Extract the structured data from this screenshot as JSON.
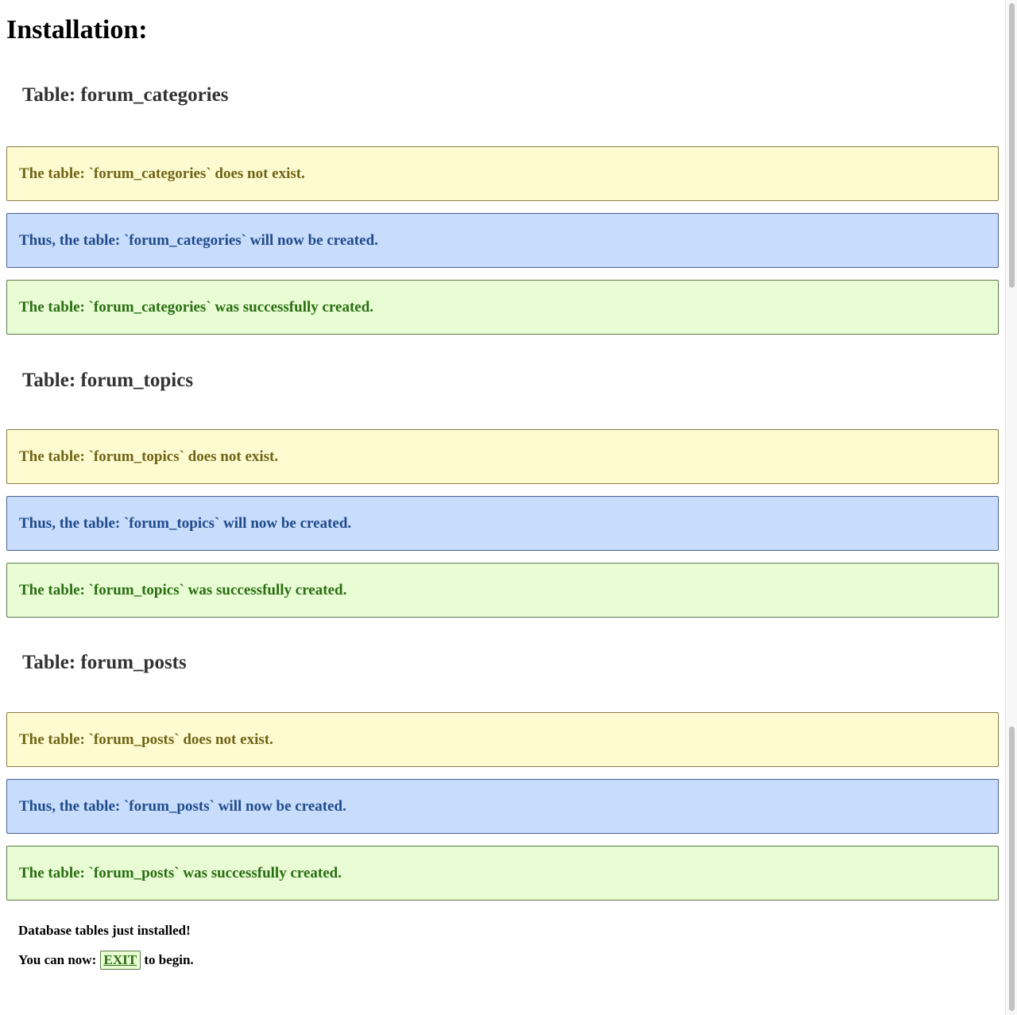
{
  "page": {
    "title": "Installation:"
  },
  "sections": [
    {
      "heading": "Table: forum_categories",
      "messages": [
        {
          "type": "warn",
          "text": "The table: `forum_categories` does not exist."
        },
        {
          "type": "info",
          "text": "Thus, the table: `forum_categories` will now be created."
        },
        {
          "type": "success",
          "text": "The table: `forum_categories` was successfully created."
        }
      ]
    },
    {
      "heading": "Table: forum_topics",
      "messages": [
        {
          "type": "warn",
          "text": "The table: `forum_topics` does not exist."
        },
        {
          "type": "info",
          "text": "Thus, the table: `forum_topics` will now be created."
        },
        {
          "type": "success",
          "text": "The table: `forum_topics` was successfully created."
        }
      ]
    },
    {
      "heading": "Table: forum_posts",
      "messages": [
        {
          "type": "warn",
          "text": "The table: `forum_posts` does not exist."
        },
        {
          "type": "info",
          "text": "Thus, the table: `forum_posts` will now be created."
        },
        {
          "type": "success",
          "text": "The table: `forum_posts` was successfully created."
        }
      ]
    }
  ],
  "footer": {
    "installed_text": "Database tables just installed!",
    "prefix_text": "You can now:",
    "exit_label": "EXIT",
    "suffix_text": "to begin."
  },
  "colors": {
    "warn_bg": "#fffbd0",
    "info_bg": "#c8dcfc",
    "success_bg": "#e8fdd4"
  }
}
